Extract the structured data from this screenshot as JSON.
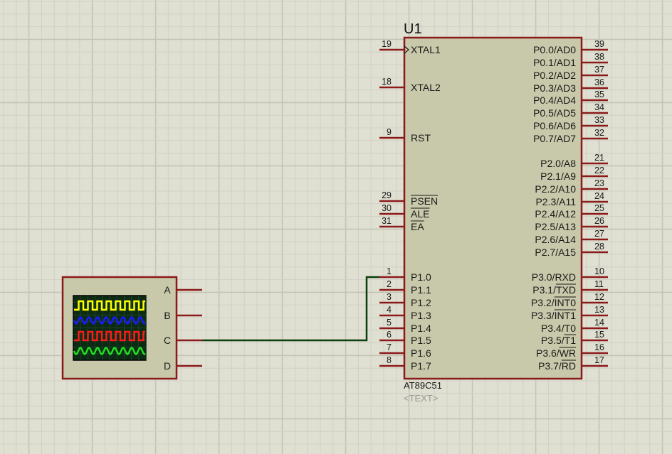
{
  "chip": {
    "ref": "U1",
    "part": "AT89C51",
    "text_placeholder": "<TEXT>",
    "left_pins": [
      {
        "num": "19",
        "label": "XTAL1"
      },
      {
        "num": "18",
        "label": "XTAL2"
      },
      {
        "num": "9",
        "label": "RST"
      },
      {
        "num": "29",
        "label": "PSEN"
      },
      {
        "num": "30",
        "label": "ALE"
      },
      {
        "num": "31",
        "label": "EA"
      },
      {
        "num": "1",
        "label": "P1.0"
      },
      {
        "num": "2",
        "label": "P1.1"
      },
      {
        "num": "3",
        "label": "P1.2"
      },
      {
        "num": "4",
        "label": "P1.3"
      },
      {
        "num": "5",
        "label": "P1.4"
      },
      {
        "num": "6",
        "label": "P1.5"
      },
      {
        "num": "7",
        "label": "P1.6"
      },
      {
        "num": "8",
        "label": "P1.7"
      }
    ],
    "right_pins": [
      {
        "num": "39",
        "label": "P0.0/AD0"
      },
      {
        "num": "38",
        "label": "P0.1/AD1"
      },
      {
        "num": "37",
        "label": "P0.2/AD2"
      },
      {
        "num": "36",
        "label": "P0.3/AD3"
      },
      {
        "num": "35",
        "label": "P0.4/AD4"
      },
      {
        "num": "34",
        "label": "P0.5/AD5"
      },
      {
        "num": "33",
        "label": "P0.6/AD6"
      },
      {
        "num": "32",
        "label": "P0.7/AD7"
      },
      {
        "num": "21",
        "label": "P2.0/A8"
      },
      {
        "num": "22",
        "label": "P2.1/A9"
      },
      {
        "num": "23",
        "label": "P2.2/A10"
      },
      {
        "num": "24",
        "label": "P2.3/A11"
      },
      {
        "num": "25",
        "label": "P2.4/A12"
      },
      {
        "num": "26",
        "label": "P2.5/A13"
      },
      {
        "num": "27",
        "label": "P2.6/A14"
      },
      {
        "num": "28",
        "label": "P2.7/A15"
      },
      {
        "num": "10",
        "label": "P3.0/RXD"
      },
      {
        "num": "11",
        "label": "P3.1/TXD"
      },
      {
        "num": "12",
        "label": "P3.2/INT0"
      },
      {
        "num": "13",
        "label": "P3.3/INT1"
      },
      {
        "num": "14",
        "label": "P3.4/T0"
      },
      {
        "num": "15",
        "label": "P3.5/T1"
      },
      {
        "num": "16",
        "label": "P3.6/WR"
      },
      {
        "num": "17",
        "label": "P3.7/RD"
      }
    ]
  },
  "oscilloscope": {
    "channels": [
      "A",
      "B",
      "C",
      "D"
    ],
    "trace_colors": [
      "#ffff00",
      "#1a1aff",
      "#ff1a1a",
      "#22dd22"
    ]
  },
  "colors": {
    "background": "#dfdfd2",
    "grid_minor": "#d0d0c4",
    "grid_major": "#c4c4b6",
    "component_outline": "#8b1a1a",
    "chip_fill": "#c8c8aa",
    "wire": "#0c3d0c",
    "scope_screen": "#0c2a14",
    "placeholder_text": "#9a9a9a"
  }
}
